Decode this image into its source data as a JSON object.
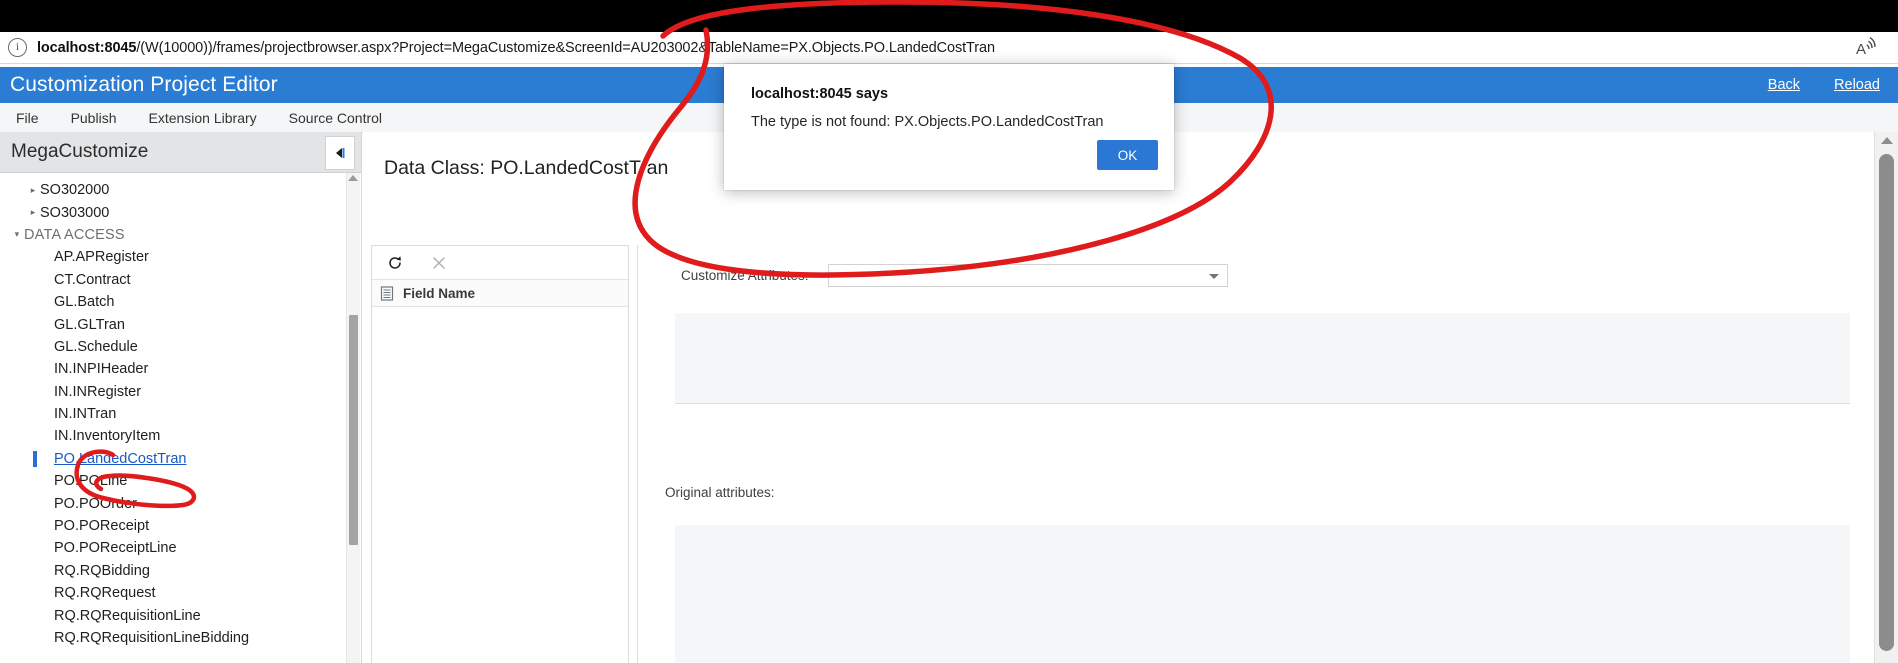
{
  "browser": {
    "url_prefix": "localhost:8045",
    "url_rest": "/(W(10000))/frames/projectbrowser.aspx?Project=MegaCustomize&ScreenId=AU203002&TableName=PX.Objects.PO.LandedCostTran",
    "info_icon": "info-icon",
    "read_aloud_icon": "read-aloud-icon"
  },
  "header": {
    "title": "Customization Project Editor",
    "links": [
      {
        "label": "Back"
      },
      {
        "label": "Reload"
      }
    ]
  },
  "menubar": {
    "items": [
      {
        "label": "File"
      },
      {
        "label": "Publish"
      },
      {
        "label": "Extension Library"
      },
      {
        "label": "Source Control"
      }
    ]
  },
  "sidebar": {
    "project_name": "MegaCustomize",
    "collapse_icon": "collapse-left-icon",
    "tree": [
      {
        "label": "SO302000",
        "level": "lvl2",
        "twisty": "▸",
        "selected": false
      },
      {
        "label": "SO303000",
        "level": "lvl2",
        "twisty": "▸",
        "selected": false
      },
      {
        "label": "DATA ACCESS",
        "level": "lvl1",
        "twisty": "▾",
        "selected": false,
        "group": true
      },
      {
        "label": "AP.APRegister",
        "level": "leaf",
        "twisty": "",
        "selected": false
      },
      {
        "label": "CT.Contract",
        "level": "leaf",
        "twisty": "",
        "selected": false
      },
      {
        "label": "GL.Batch",
        "level": "leaf",
        "twisty": "",
        "selected": false
      },
      {
        "label": "GL.GLTran",
        "level": "leaf",
        "twisty": "",
        "selected": false
      },
      {
        "label": "GL.Schedule",
        "level": "leaf",
        "twisty": "",
        "selected": false
      },
      {
        "label": "IN.INPIHeader",
        "level": "leaf",
        "twisty": "",
        "selected": false
      },
      {
        "label": "IN.INRegister",
        "level": "leaf",
        "twisty": "",
        "selected": false
      },
      {
        "label": "IN.INTran",
        "level": "leaf",
        "twisty": "",
        "selected": false
      },
      {
        "label": "IN.InventoryItem",
        "level": "leaf",
        "twisty": "",
        "selected": false
      },
      {
        "label": "PO.LandedCostTran",
        "level": "leaf",
        "twisty": "",
        "selected": true
      },
      {
        "label": "PO.POLine",
        "level": "leaf",
        "twisty": "",
        "selected": false
      },
      {
        "label": "PO.POOrder",
        "level": "leaf",
        "twisty": "",
        "selected": false
      },
      {
        "label": "PO.POReceipt",
        "level": "leaf",
        "twisty": "",
        "selected": false
      },
      {
        "label": "PO.POReceiptLine",
        "level": "leaf",
        "twisty": "",
        "selected": false
      },
      {
        "label": "RQ.RQBidding",
        "level": "leaf",
        "twisty": "",
        "selected": false
      },
      {
        "label": "RQ.RQRequest",
        "level": "leaf",
        "twisty": "",
        "selected": false
      },
      {
        "label": "RQ.RQRequisitionLine",
        "level": "leaf",
        "twisty": "",
        "selected": false
      },
      {
        "label": "RQ.RQRequisitionLineBidding",
        "level": "leaf",
        "twisty": "",
        "selected": false
      }
    ]
  },
  "main": {
    "data_class_title": "Data Class: PO.LandedCostTran",
    "field_panel": {
      "refresh_icon": "refresh-icon",
      "delete_icon": "close-x-icon",
      "column_icon": "grid-column-icon",
      "column_header": "Field Name",
      "rows": []
    },
    "attributes": {
      "customize_label": "Customize Attributes:",
      "customize_value": "",
      "dropdown_icon": "chevron-down-icon",
      "original_label": "Original attributes:",
      "original_value": ""
    }
  },
  "alert": {
    "title": "localhost:8045 says",
    "message": "The type is not found: PX.Objects.PO.LandedCostTran",
    "ok_label": "OK",
    "accent_color": "#2b77d4"
  },
  "annotations": {
    "ink_color": "#e01b1b",
    "shapes": [
      {
        "name": "circle-around-alert-dialog"
      },
      {
        "name": "circle-around-selected-tree-item"
      }
    ]
  }
}
